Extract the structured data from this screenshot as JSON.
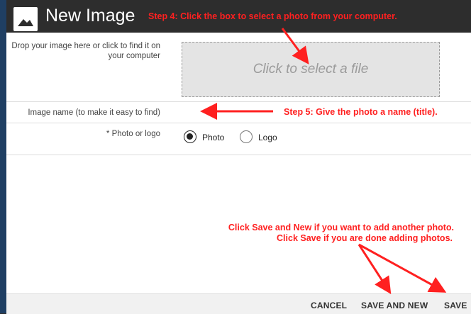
{
  "window": {
    "title": "New Image",
    "title_icon": "image-icon"
  },
  "form": {
    "drop_label": "Drop your image here or click to find it on your computer",
    "dropzone_text": "Click to select a file",
    "name_placeholder": "Image name (to make it easy to find)",
    "photo_or_logo_label": "* Photo or logo",
    "options": [
      {
        "label": "Photo",
        "selected": true
      },
      {
        "label": "Logo",
        "selected": false
      }
    ]
  },
  "annotations": {
    "step4": "Step 4: Click the box to select a photo from your computer.",
    "step5": "Step 5: Give the photo a name (title).",
    "note_line1": "Click Save and New if you want to add another photo.",
    "note_line2": "Click Save if you are done adding photos.",
    "annotation_color": "#ff2020"
  },
  "footer": {
    "cancel": "CANCEL",
    "save_and_new": "SAVE AND NEW",
    "save": "SAVE"
  }
}
